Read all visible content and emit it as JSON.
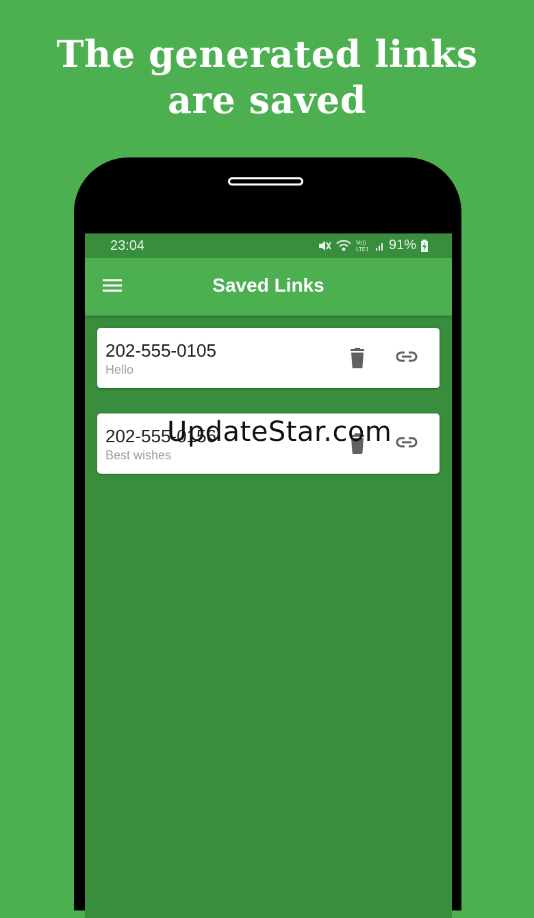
{
  "headline": {
    "line1": "The generated links",
    "line2": "are saved"
  },
  "status_bar": {
    "time": "23:04",
    "battery": "91%",
    "network": "LTE1"
  },
  "app_bar": {
    "title": "Saved Links"
  },
  "saved_links": [
    {
      "phone": "202-555-0105",
      "message": "Hello"
    },
    {
      "phone": "202-555-0156",
      "message": "Best wishes"
    }
  ],
  "watermark": "UpdateStar.com",
  "colors": {
    "background": "#4caf50",
    "app_bar": "#4caf50",
    "screen": "#388e3c",
    "card": "#ffffff"
  },
  "icons": [
    "menu-icon",
    "mute-icon",
    "wifi-icon",
    "volte-icon",
    "signal-icon",
    "battery-icon",
    "delete-icon",
    "link-icon"
  ]
}
